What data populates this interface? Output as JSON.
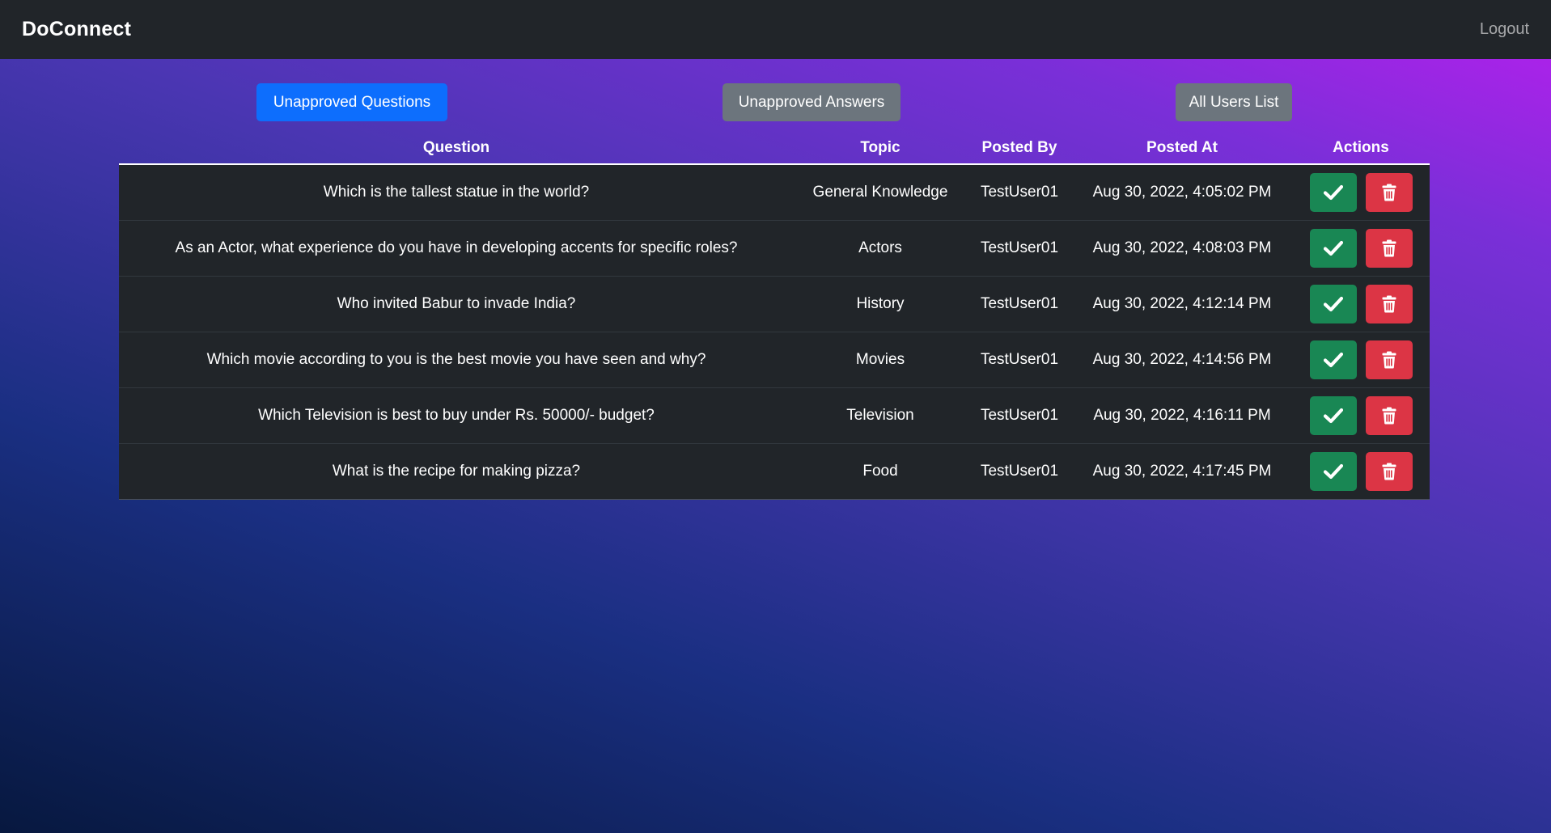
{
  "navbar": {
    "brand": "DoConnect",
    "logout": "Logout"
  },
  "tabs": {
    "unapproved_questions": "Unapproved Questions",
    "unapproved_answers": "Unapproved Answers",
    "all_users": "All Users List"
  },
  "table": {
    "headers": {
      "question": "Question",
      "topic": "Topic",
      "posted_by": "Posted By",
      "posted_at": "Posted At",
      "actions": "Actions"
    },
    "rows": [
      {
        "question": "Which is the tallest statue in the world?",
        "topic": "General Knowledge",
        "posted_by": "TestUser01",
        "posted_at": "Aug 30, 2022, 4:05:02 PM"
      },
      {
        "question": "As an Actor, what experience do you have in developing accents for specific roles?",
        "topic": "Actors",
        "posted_by": "TestUser01",
        "posted_at": "Aug 30, 2022, 4:08:03 PM"
      },
      {
        "question": "Who invited Babur to invade India?",
        "topic": "History",
        "posted_by": "TestUser01",
        "posted_at": "Aug 30, 2022, 4:12:14 PM"
      },
      {
        "question": "Which movie according to you is the best movie you have seen and why?",
        "topic": "Movies",
        "posted_by": "TestUser01",
        "posted_at": "Aug 30, 2022, 4:14:56 PM"
      },
      {
        "question": "Which Television is best to buy under Rs. 50000/- budget?",
        "topic": "Television",
        "posted_by": "TestUser01",
        "posted_at": "Aug 30, 2022, 4:16:11 PM"
      },
      {
        "question": "What is the recipe for making pizza?",
        "topic": "Food",
        "posted_by": "TestUser01",
        "posted_at": "Aug 30, 2022, 4:17:45 PM"
      }
    ]
  },
  "icons": {
    "approve": "check-icon",
    "delete": "trash-icon"
  },
  "colors": {
    "navbar": "#212529",
    "primary": "#0d6efd",
    "secondary": "#6c757d",
    "success": "#198754",
    "danger": "#dc3545"
  }
}
